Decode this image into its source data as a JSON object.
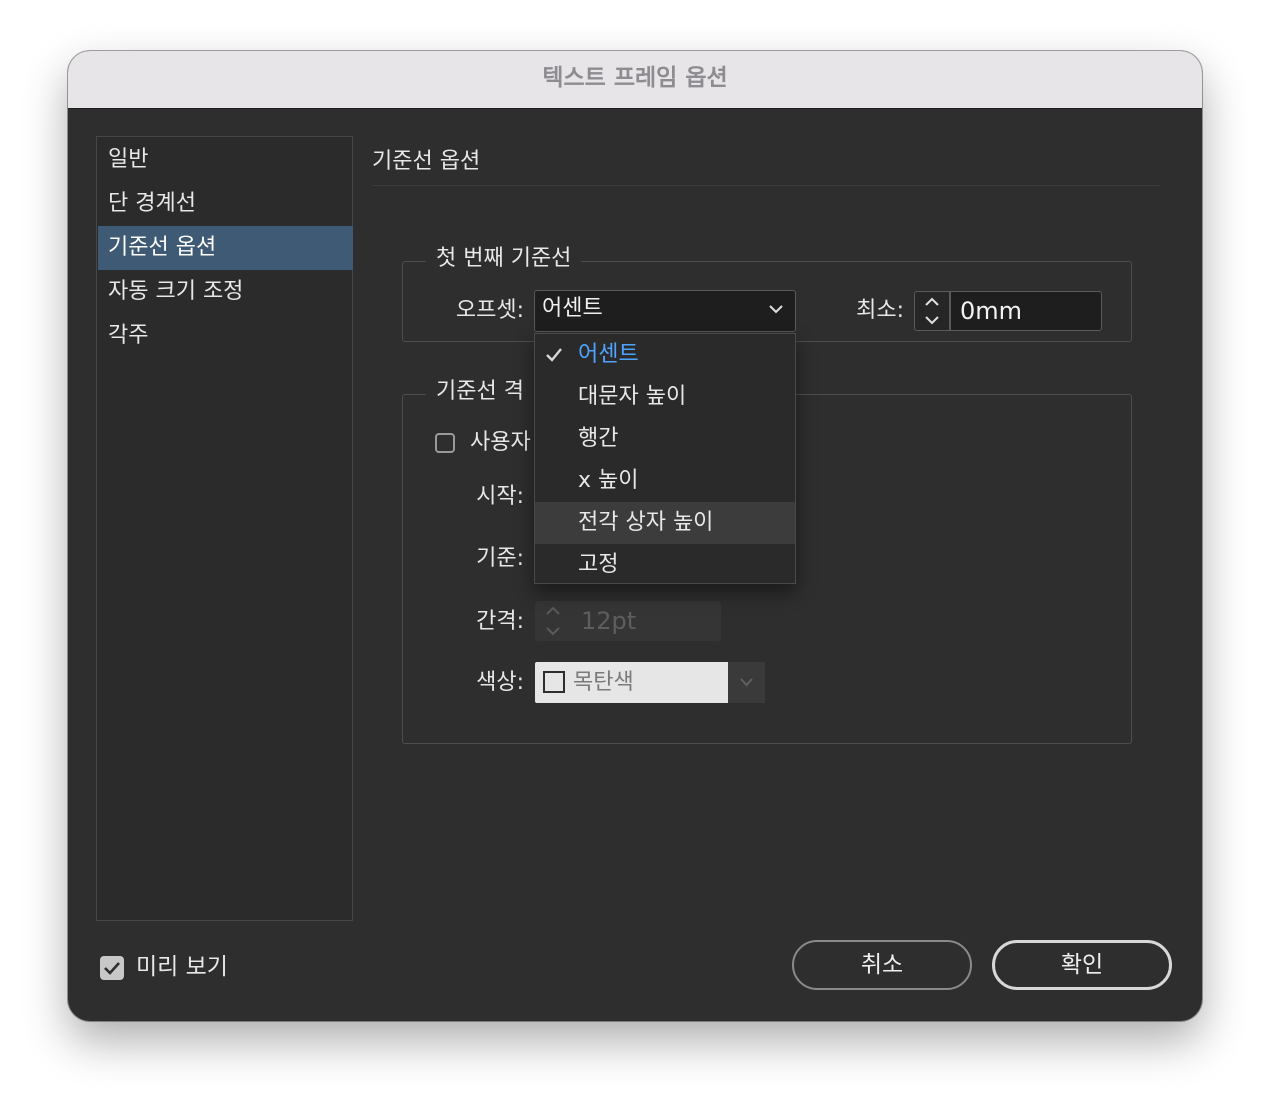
{
  "window": {
    "title": "텍스트 프레임 옵션"
  },
  "sidebar": {
    "items": [
      {
        "label": "일반"
      },
      {
        "label": "단 경계선"
      },
      {
        "label": "기준선 옵션"
      },
      {
        "label": "자동 크기 조정"
      },
      {
        "label": "각주"
      }
    ],
    "selected": "기준선 옵션"
  },
  "main": {
    "title": "기준선 옵션",
    "first_baseline": {
      "legend": "첫 번째 기준선",
      "offset_label": "오프셋:",
      "offset_value": "어센트",
      "min_label": "최소:",
      "min_value": "0mm"
    },
    "baseline_grid": {
      "legend": "기준선 격",
      "custom_label": "사용자",
      "start_label": "시작:",
      "relative_label": "기준:",
      "increment_label": "간격:",
      "increment_value": "12pt",
      "color_label": "색상:",
      "color_value": "목탄색"
    }
  },
  "dropdown": {
    "items": [
      {
        "label": "어센트",
        "checked": true
      },
      {
        "label": "대문자 높이"
      },
      {
        "label": "행간"
      },
      {
        "label": "x 높이"
      },
      {
        "label": "전각 상자 높이",
        "hovered": true
      },
      {
        "label": "고정"
      }
    ]
  },
  "footer": {
    "preview_label": "미리 보기",
    "preview_checked": true,
    "cancel_label": "취소",
    "ok_label": "확인"
  },
  "colors": {
    "accent": "#4ea3ff",
    "selection": "#3e5a74",
    "panel": "#2e2e2e"
  },
  "icons": [
    "check-icon",
    "chevron-down-icon",
    "stepper-icon",
    "checkbox-icon"
  ]
}
